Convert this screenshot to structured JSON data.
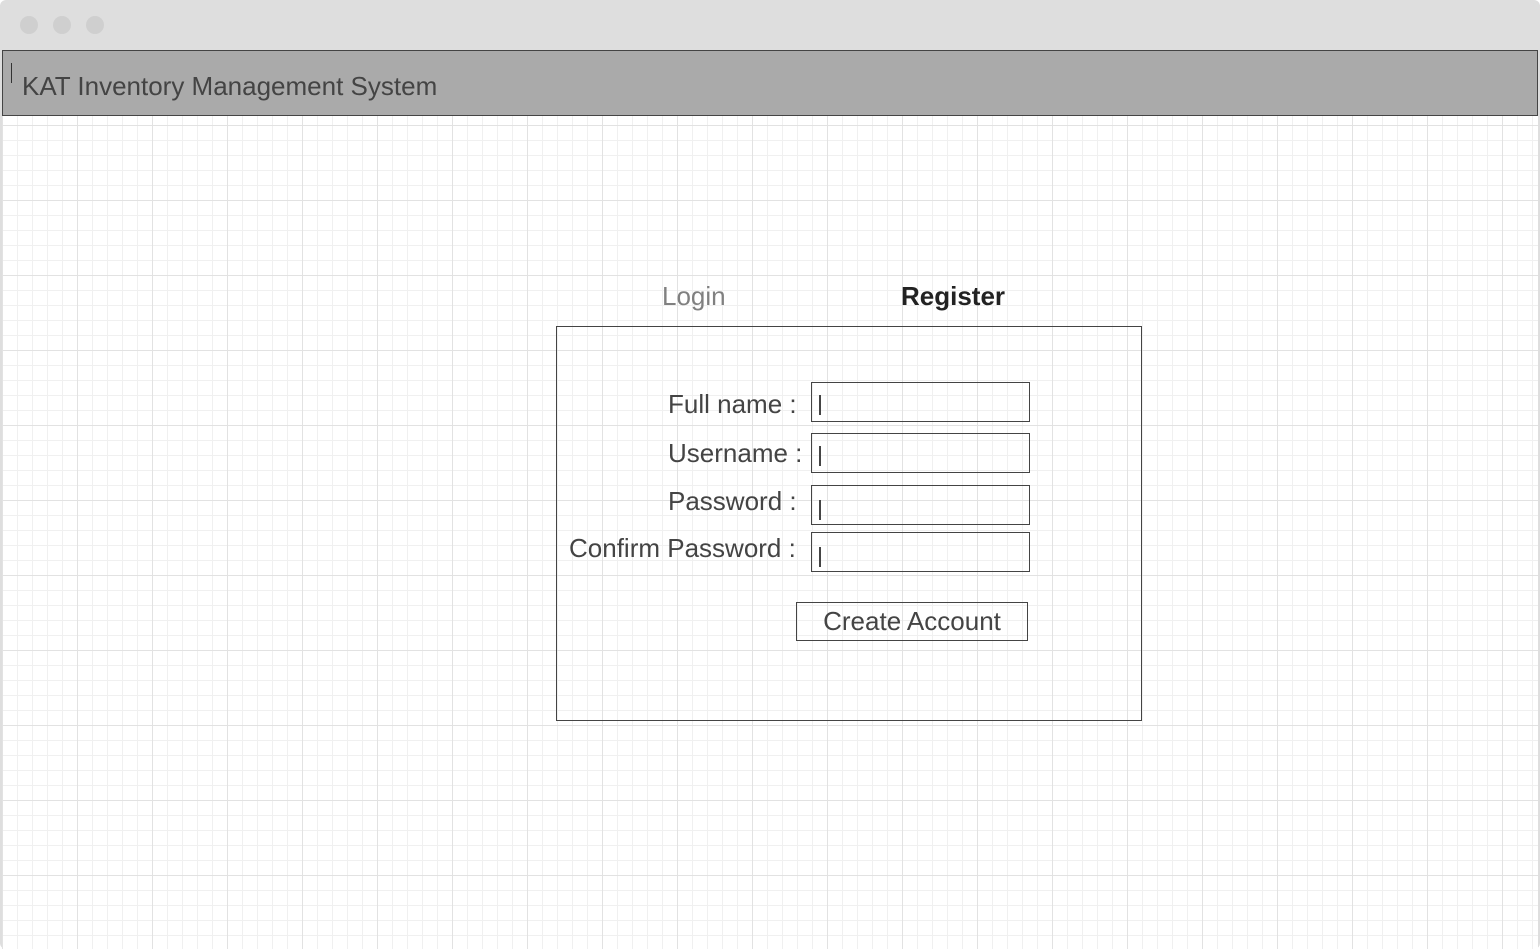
{
  "window": {
    "controls": [
      "close",
      "minimize",
      "maximize"
    ]
  },
  "header": {
    "title": "KAT Inventory Management System"
  },
  "tabs": [
    {
      "label": "Login",
      "active": false
    },
    {
      "label": "Register",
      "active": true
    }
  ],
  "form": {
    "fields": [
      {
        "label": "Full name :",
        "value": ""
      },
      {
        "label": "Username :",
        "value": ""
      },
      {
        "label": "Password :",
        "value": ""
      },
      {
        "label": "Confirm Password :",
        "value": ""
      }
    ],
    "submit_label": "Create Account"
  }
}
